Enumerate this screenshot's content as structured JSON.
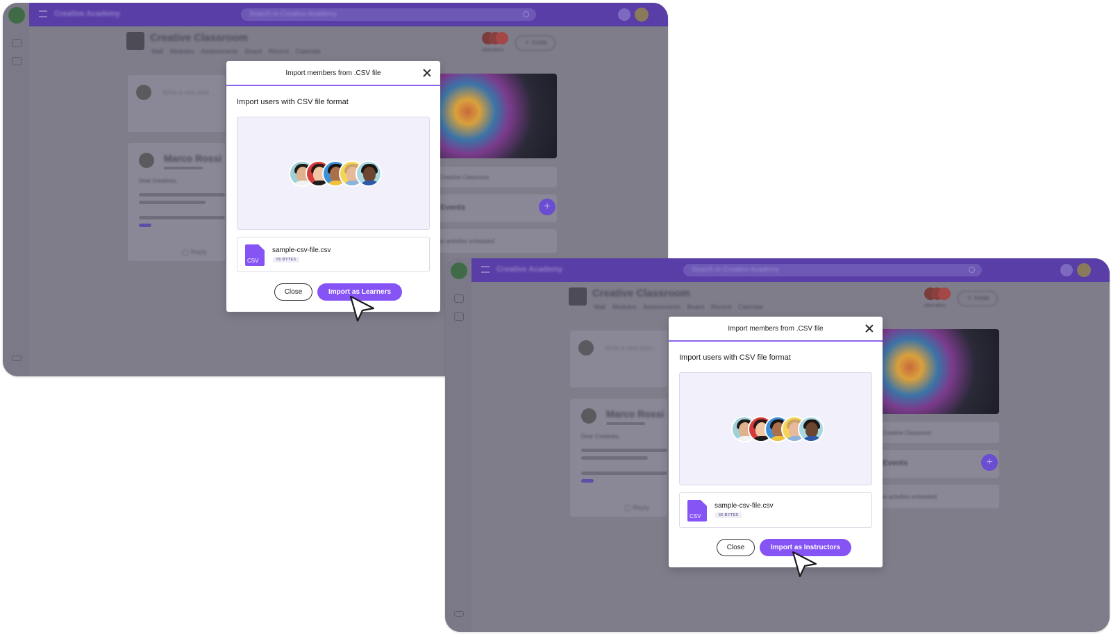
{
  "background": {
    "brand": "Creative Academy",
    "search_placeholder": "Search in Creative Academy",
    "course_title": "Creative Classroom",
    "course_tabs": [
      "Wall",
      "Modules",
      "Assessments",
      "Board",
      "Record",
      "Calendar"
    ],
    "attendees_label": "Attendees",
    "invite_label": "Invite",
    "post_placeholder": "Write a new post...",
    "author_name": "Marco Rossi",
    "post_greeting": "Dear Creatives,",
    "reply_label": "Reply",
    "classroom_note": "Creative Classroom",
    "section_label": "Events",
    "activities_note": "No activities scheduled",
    "colors": {
      "topbar": "#5a3ea8",
      "overlay": "#7f7d8a"
    }
  },
  "dialogs": [
    {
      "title": "Import members from .CSV file",
      "subtitle": "Import users with CSV file format",
      "file_name": "sample-csv-file.csv",
      "file_size": "55 BYTES",
      "file_icon_label": "CSV",
      "close_label": "Close",
      "import_label": "Import as Learners"
    },
    {
      "title": "Import members from .CSV file",
      "subtitle": "Import users with CSV file format",
      "file_name": "sample-csv-file.csv",
      "file_size": "55 BYTES",
      "file_icon_label": "CSV",
      "close_label": "Close",
      "import_label": "Import as Instructors"
    }
  ],
  "colors": {
    "accent": "#8653f5",
    "divider": "#8b63f3",
    "preview_bg": "#f2f0fb"
  }
}
